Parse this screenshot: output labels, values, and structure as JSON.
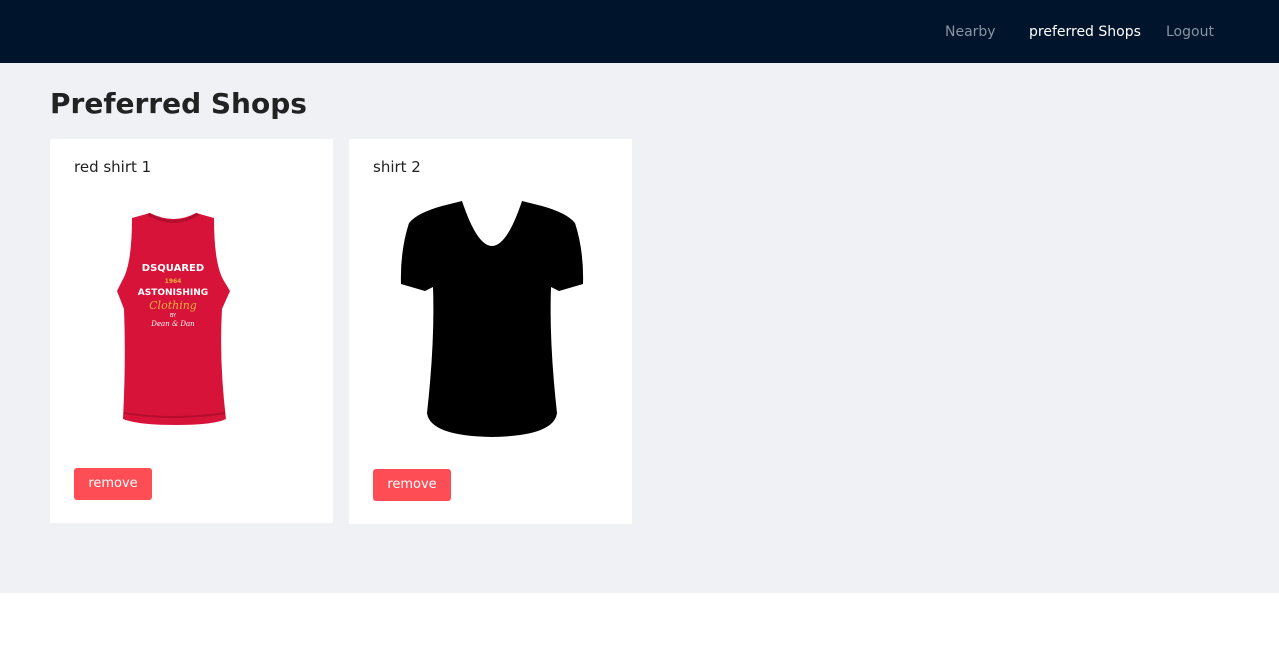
{
  "nav": {
    "items": [
      {
        "label": "Nearby",
        "active": false
      },
      {
        "label": "preferred Shops",
        "active": true
      },
      {
        "label": "Logout",
        "active": false
      }
    ]
  },
  "page": {
    "title": "Preferred Shops"
  },
  "shops": [
    {
      "name": "red shirt 1",
      "image": {
        "icon": "red-sleeveless-shirt-image",
        "color": "#d8133a",
        "print_lines": [
          "DSQUARED",
          "1964",
          "ASTONISHING",
          "Clothing",
          "BY",
          "Dean & Dan"
        ]
      },
      "button_label": "remove"
    },
    {
      "name": "shirt 2",
      "image": {
        "icon": "black-vneck-tshirt-image",
        "color": "#000000"
      },
      "button_label": "remove"
    }
  ],
  "colors": {
    "navbar": "#00142b",
    "background": "#f0f1f5",
    "remove_button": "#ff4d55"
  }
}
